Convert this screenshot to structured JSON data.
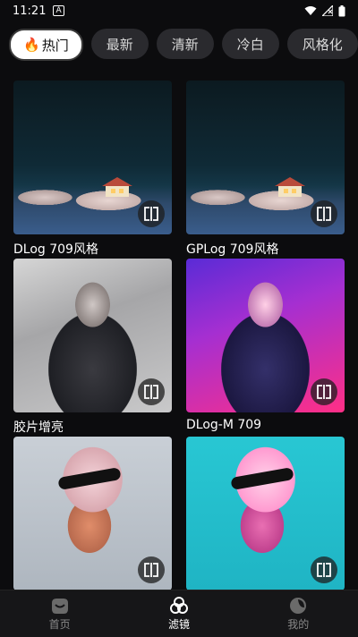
{
  "status": {
    "time": "11:21",
    "sim_badge": "A"
  },
  "chips": [
    {
      "label": "热门",
      "icon": "fire-icon",
      "active": true
    },
    {
      "label": "最新"
    },
    {
      "label": "清新"
    },
    {
      "label": "冷白"
    },
    {
      "label": "风格化"
    }
  ],
  "filters": [
    {
      "label": "DLog 709风格"
    },
    {
      "label": "GPLog 709风格"
    },
    {
      "label": "胶片增亮"
    },
    {
      "label": "DLog-M 709"
    },
    {
      "label": ""
    },
    {
      "label": ""
    }
  ],
  "nav": [
    {
      "label": "首页",
      "icon": "home-icon"
    },
    {
      "label": "滤镜",
      "icon": "filter-icon",
      "active": true
    },
    {
      "label": "我的",
      "icon": "profile-icon"
    }
  ]
}
